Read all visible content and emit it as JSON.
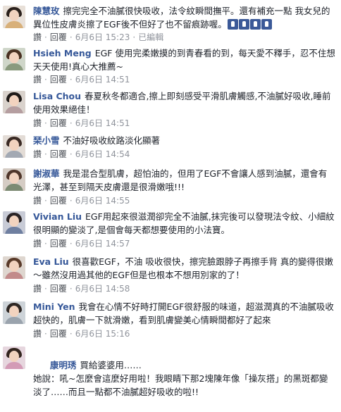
{
  "comments": [
    {
      "author": "陳慧玫",
      "text": "擦完完全不油膩很快吸收，法令紋瞬間撫平。還有補充一點 我女兒的異位性皮膚炎擦了EGF後不但好了也不留痕跡喔。",
      "actions": [
        "讚",
        "回覆"
      ],
      "date": "6月6日 15:23",
      "edited": "已編輯",
      "thumbs": [
        "like-icon",
        "like-icon",
        "like-icon",
        "like-icon"
      ]
    },
    {
      "author": "Hsieh Meng",
      "text": "EGF 使用完柔嫩摸的到青春看的到，每天愛不釋手，忍不住想天天使用!真心大推薦~",
      "actions": [
        "讚",
        "回覆"
      ],
      "date": "6月6日 14:51"
    },
    {
      "author": "Lisa Chou",
      "text": "春夏秋冬都適合,擦上即刻感受平滑肌膚觸感,不油膩好吸收,睡前使用效果絕佳！",
      "actions": [
        "讚",
        "回覆"
      ],
      "date": "6月6日 14:51"
    },
    {
      "author": "琹小雪",
      "text": "不油好吸收紋路淡化顯著",
      "actions": [
        "讚",
        "回覆"
      ],
      "date": "6月6日 14:54"
    },
    {
      "author": "謝淑華",
      "text": "我是混合型肌膚，超怕油的，但用了EGF不會讓人感到油膩，還會有光澤，甚至到隔天皮膚還是很滑嫩哦!!!",
      "actions": [
        "讚",
        "回覆"
      ],
      "date": "6月6日 14:55"
    },
    {
      "author": "Vivian Liu",
      "text": "EGF用起來很滋潤卻完全不油膩,抹完後可以發現法令紋、小細紋很明顯的變淡了,是個會每天都想要使用的小法寶。",
      "actions": [
        "讚",
        "回覆"
      ],
      "date": "6月6日 14:57"
    },
    {
      "author": "Eva Liu",
      "text": "很喜歡EGF，不油 吸收很快，擦完臉跟脖子再擦手背 真的變得很嫩～雖然沒用過其他的EGF但是也根本不想用別家的了！",
      "actions": [
        "讚",
        "回覆"
      ],
      "date": "6月6日 14:58"
    },
    {
      "author": "Mini Yen",
      "text": "我會在心情不好時打開EGF很舒服的味道，超滋潤真的不油膩吸收超快的，肌膚一下就滑嫩，看到肌膚變美心情瞬間都好了起來",
      "actions": [
        "讚",
        "回覆"
      ],
      "date": "6月6日 15:16"
    },
    {
      "author": "康明琇",
      "text": "買給婆婆用……\n她說：吼~怎麼會這麼好用啦！我眼睛下那2塊陳年像「操灰搭」的黑斑都變淡了……而且一點都不油膩超好吸收的啦!!",
      "actions": [],
      "date": ""
    }
  ],
  "colors": {
    "author": "#365899",
    "text": "#1d2129",
    "meta": "#90949c",
    "background": "#ffffff"
  }
}
